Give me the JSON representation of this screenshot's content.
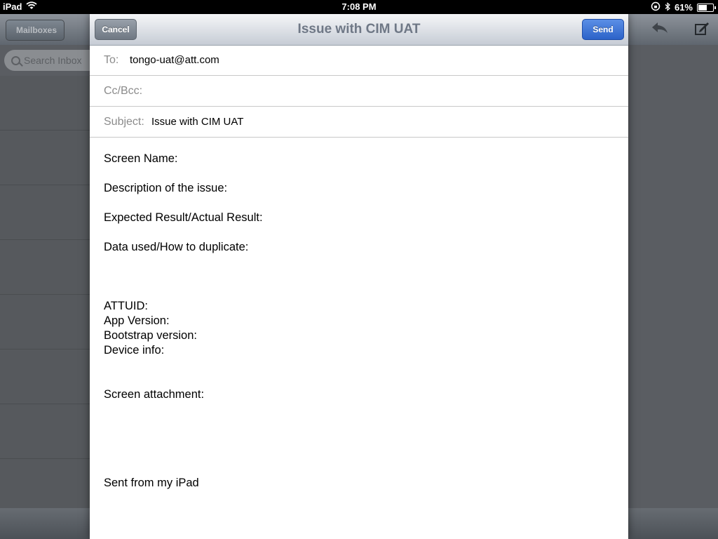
{
  "status_bar": {
    "device": "iPad",
    "time": "7:08 PM",
    "battery": "61%",
    "battery_level": 0.61,
    "icons": [
      "wifi-icon",
      "rotation-lock-icon",
      "bluetooth-icon",
      "battery-icon"
    ]
  },
  "background": {
    "mailboxes_label": "Mailboxes",
    "search_placeholder": "Search Inbox"
  },
  "compose": {
    "title": "Issue with CIM UAT",
    "cancel_label": "Cancel",
    "send_label": "Send",
    "to_label": "To:",
    "to_value": "tongo-uat@att.com",
    "ccbcc_label": "Cc/Bcc:",
    "subject_label": "Subject:",
    "subject_value": "Issue with CIM UAT",
    "body_lines": [
      "Screen Name:",
      "",
      "Description of the issue:",
      "",
      "Expected Result/Actual Result:",
      "",
      "Data used/How to duplicate:",
      "",
      "",
      "",
      "ATTUID:",
      "App Version:",
      "Bootstrap version:",
      "Device info:",
      "",
      "",
      "Screen attachment:",
      "",
      "",
      "",
      "",
      "",
      "Sent from my iPad"
    ]
  },
  "colors": {
    "send_button": "#2c62c8",
    "nav_title": "#6f7886",
    "field_label": "#8b8b8b"
  }
}
